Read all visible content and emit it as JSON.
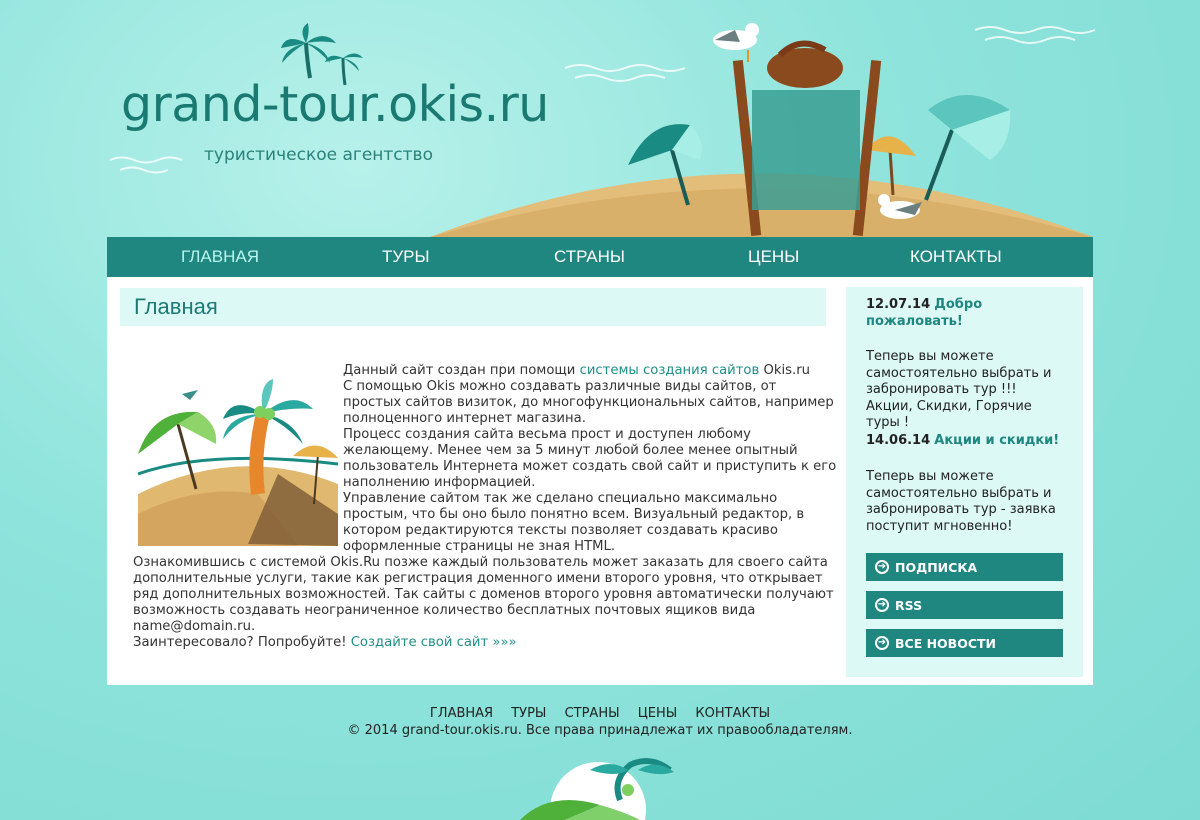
{
  "site": {
    "logo": "grand-tour.okis.ru",
    "tagline": "туристическое агентство"
  },
  "nav": {
    "items": [
      "ГЛАВНАЯ",
      "ТУРЫ",
      "СТРАНЫ",
      "ЦЕНЫ",
      "КОНТАКТЫ"
    ],
    "active": "ГЛАВНАЯ"
  },
  "main": {
    "title": "Главная",
    "lines": [
      {
        "pre": "Данный сайт создан при помощи ",
        "link": "системы создания сайтов",
        "post": " Okis.ru"
      },
      {
        "pre": "С помощью Okis можно создавать различные виды сайтов, от"
      },
      {
        "pre": "простых сайтов визиток, до многофункциональных сайтов, например"
      },
      {
        "pre": "полноценного интернет магазина."
      },
      {
        "pre": "Процесс создания сайта весьма прост и доступен любому"
      },
      {
        "pre": "желающему. Менее чем за 5 минут любой более менее опытный"
      },
      {
        "pre": "пользователь Интернета может создать свой сайт и приступить к его"
      },
      {
        "pre": "наполнению информацией."
      },
      {
        "pre": "Управление сайтом так же сделано специально максимально"
      },
      {
        "pre": "простым, что бы оно было понятно всем. Визуальный редактор, в"
      },
      {
        "pre": "котором редактируются тексты позволяет создавать красиво"
      },
      {
        "pre": "оформленные страницы не зная HTML."
      },
      {
        "pre": "Ознакомившись с системой Okis.Ru позже каждый пользователь может заказать для своего сайта"
      },
      {
        "pre": "дополнительные услуги, такие как регистрация доменного имени второго уровня, что открывает"
      },
      {
        "pre": "ряд дополнительных возможностей. Так сайты с доменов второго уровня автоматически получают"
      },
      {
        "pre": "возможность создавать неограниченное количество бесплатных почтовых ящиков вида"
      },
      {
        "pre": "name@domain.ru."
      },
      {
        "pre": "Заинтересовало? Попробуйте! ",
        "link": "Создайте свой сайт »»»"
      }
    ]
  },
  "sidebar": {
    "news": [
      {
        "date": "12.07.14",
        "title": "Добро пожаловать!",
        "body": "Теперь вы можете самостоятельно выбрать и забронировать тур !!! Акции, Скидки, Горячие туры !"
      },
      {
        "date": "14.06.14",
        "title": "Акции и скидки!",
        "body": "Теперь вы можете самостоятельно выбрать и забронировать тур - заявка поступит мгновенно!"
      }
    ],
    "buttons": [
      "ПОДПИСКА",
      "RSS",
      "ВСЕ НОВОСТИ"
    ]
  },
  "footer": {
    "nav": [
      "ГЛАВНАЯ",
      "ТУРЫ",
      "СТРАНЫ",
      "ЦЕНЫ",
      "КОНТАКТЫ"
    ],
    "copyright": "© 2014 grand-tour.okis.ru. Все права принадлежат их правообладателям."
  },
  "colors": {
    "accent": "#1f8680",
    "background": "#8fe4dc",
    "sidebar": "#dcf9f6"
  }
}
